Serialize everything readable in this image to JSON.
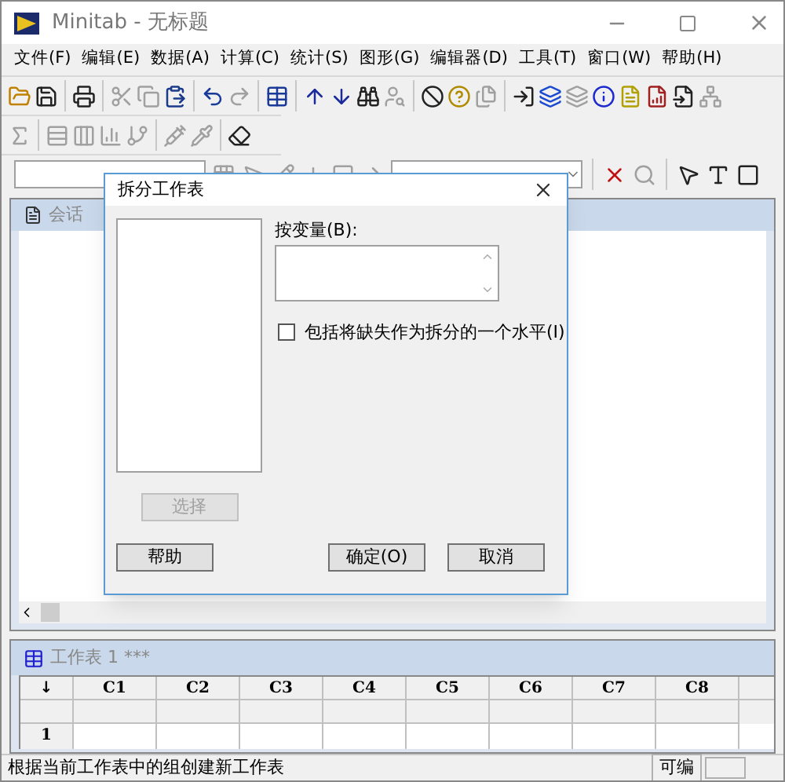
{
  "window": {
    "title": "Minitab - 无标题"
  },
  "menu": [
    "文件(F)",
    "编辑(E)",
    "数据(A)",
    "计算(C)",
    "统计(S)",
    "图形(G)",
    "编辑器(D)",
    "工具(T)",
    "窗口(W)",
    "帮助(H)"
  ],
  "session": {
    "title": "会话"
  },
  "dialog": {
    "title": "拆分工作表",
    "field_label": "按变量(B):",
    "checkbox": {
      "label": "包括将缺失作为拆分的一个水平(I)",
      "checked": false
    },
    "buttons": [
      {
        "label": "选择",
        "kind": "select",
        "disabled": true
      },
      {
        "label": "帮助",
        "kind": "help",
        "disabled": false
      },
      {
        "label": "确定(O)",
        "kind": "ok",
        "disabled": false
      },
      {
        "label": "取消",
        "kind": "cancel",
        "disabled": false
      }
    ]
  },
  "worksheet": {
    "title": "工作表 1 ***",
    "corner": "↓",
    "columns": [
      "C1",
      "C2",
      "C3",
      "C4",
      "C5",
      "C6",
      "C7",
      "C8"
    ],
    "rows": [
      "1"
    ]
  },
  "status_bar": {
    "message": "根据当前工作表中的组创建新工作表",
    "mode": "可编"
  }
}
